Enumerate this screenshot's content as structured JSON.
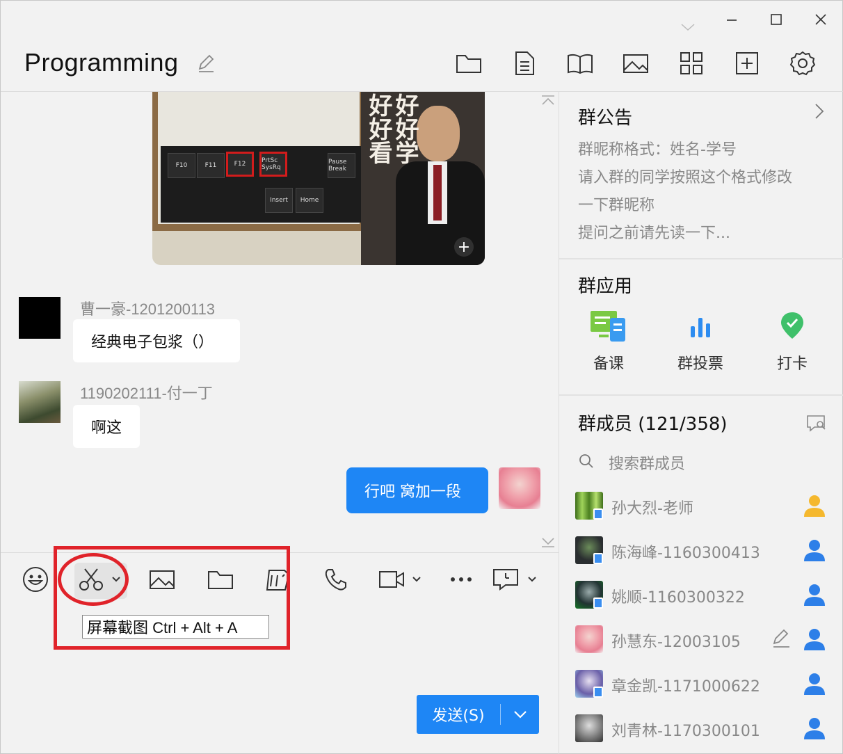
{
  "window": {
    "title": "Programming",
    "controls": [
      "minimize-icon",
      "maximize-icon",
      "close-icon",
      "collapse-icon"
    ]
  },
  "toolbar": {
    "icons": [
      "folder-icon",
      "document-icon",
      "book-icon",
      "image-icon",
      "apps-grid-icon",
      "add-window-icon",
      "gear-icon"
    ]
  },
  "chat": {
    "messages": [
      {
        "sender": "曹一豪-1201200113",
        "text": "经典电子包浆（）"
      },
      {
        "sender": "1190202111-付一丁",
        "text": "啊这"
      },
      {
        "sender": "",
        "text": "行吧 窝加一段",
        "mine": true
      }
    ],
    "image_caption_a": "好好看",
    "image_caption_b": "好好学",
    "keys": [
      "F10",
      "F11",
      "F12",
      "PrtSc SysRq",
      "Pause Break",
      "Insert",
      "Home"
    ]
  },
  "input_toolbar": {
    "icons": [
      "emoji-icon",
      "scissors-icon",
      "image-icon",
      "folder-icon",
      "doc-sticker-icon",
      "phone-icon",
      "video-icon",
      "more-icon",
      "screen-share-icon"
    ],
    "tooltip": "屏幕截图 Ctrl + Alt + A"
  },
  "send": {
    "label": "发送(S)"
  },
  "right_panel": {
    "notice": {
      "title": "群公告",
      "lines": [
        "群昵称格式：姓名-学号",
        "请入群的同学按照这个格式修改",
        "一下群昵称",
        "提问之前请先读一下..."
      ]
    },
    "apps": {
      "title": "群应用",
      "items": [
        {
          "label": "备课",
          "color": "#7ac943"
        },
        {
          "label": "群投票",
          "color": "#2d8cf0"
        },
        {
          "label": "打卡",
          "color": "#3fc06a"
        }
      ]
    },
    "members": {
      "title": "群成员 (121/358)",
      "search_placeholder": "搜索群成员",
      "list": [
        {
          "name": "孙大烈-老师",
          "role": "owner",
          "color": "#f5b82e"
        },
        {
          "name": "陈海峰-1160300413",
          "role": "member",
          "color": "#2d7fe8"
        },
        {
          "name": "姚顺-1160300322",
          "role": "member",
          "color": "#2d7fe8"
        },
        {
          "name": "孙慧东-12003105",
          "role": "member",
          "color": "#2d7fe8"
        },
        {
          "name": "章金凯-1171000622",
          "role": "member",
          "color": "#2d7fe8"
        },
        {
          "name": "刘青林-1170300101",
          "role": "member",
          "color": "#2d7fe8"
        }
      ]
    }
  }
}
